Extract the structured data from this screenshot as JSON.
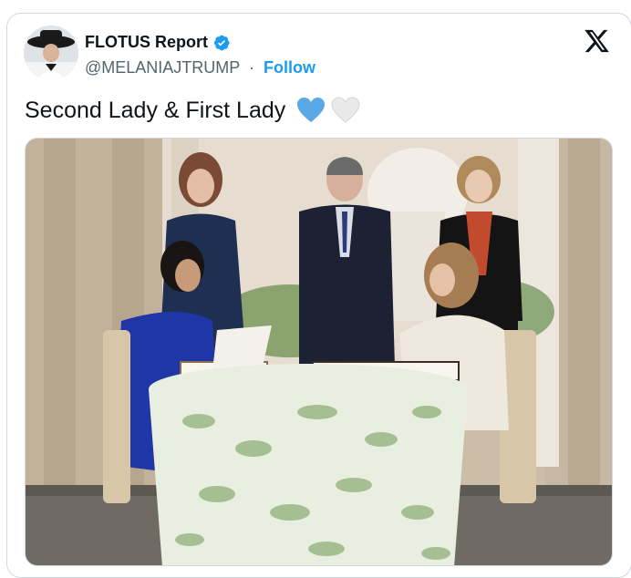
{
  "tweet": {
    "display_name": "FLOTUS Report",
    "handle": "@MELANIAJTRUMP",
    "separator": "·",
    "follow_label": "Follow",
    "text": "Second Lady & First Lady",
    "emojis": [
      "blue-heart",
      "white-heart"
    ],
    "verified_color": "#1d9bf0",
    "accent_color": "#1d9bf0"
  },
  "icons": {
    "platform": "x-logo-icon",
    "verified": "verified-badge-icon"
  },
  "media": {
    "description": "Photo of a document signing at a round table"
  }
}
